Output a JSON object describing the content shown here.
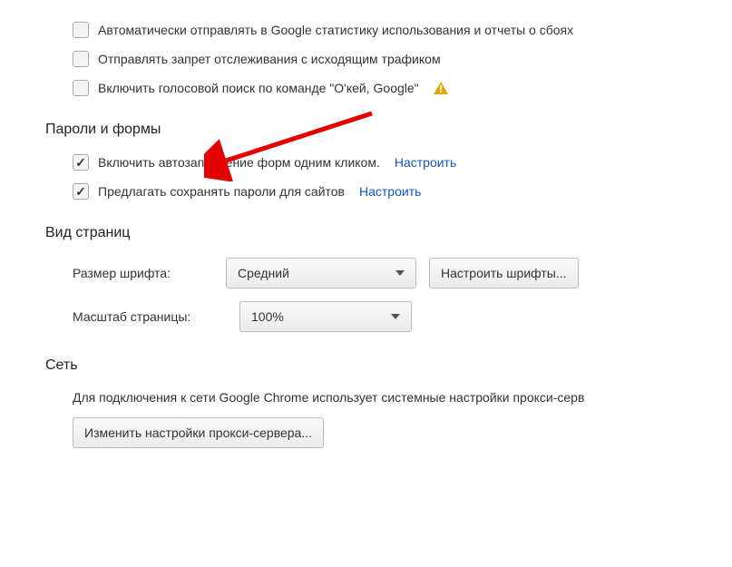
{
  "privacy": {
    "stats_label": "Автоматически отправлять в Google статистику использования и отчеты о сбоях",
    "dnt_label": "Отправлять запрет отслеживания с исходящим трафиком",
    "voice_label": "Включить голосовой поиск по команде \"О'кей, Google\""
  },
  "passwords": {
    "heading": "Пароли и формы",
    "autofill_label": "Включить автозаполнение форм одним кликом.",
    "autofill_link": "Настроить",
    "save_pw_label": "Предлагать сохранять пароли для сайтов",
    "save_pw_link": "Настроить"
  },
  "appearance": {
    "heading": "Вид страниц",
    "font_size_label": "Размер шрифта:",
    "font_size_value": "Средний",
    "font_customize_btn": "Настроить шрифты...",
    "zoom_label": "Масштаб страницы:",
    "zoom_value": "100%"
  },
  "network": {
    "heading": "Сеть",
    "desc": "Для подключения к сети Google Chrome использует системные настройки прокси-серв",
    "proxy_btn": "Изменить настройки прокси-сервера..."
  }
}
